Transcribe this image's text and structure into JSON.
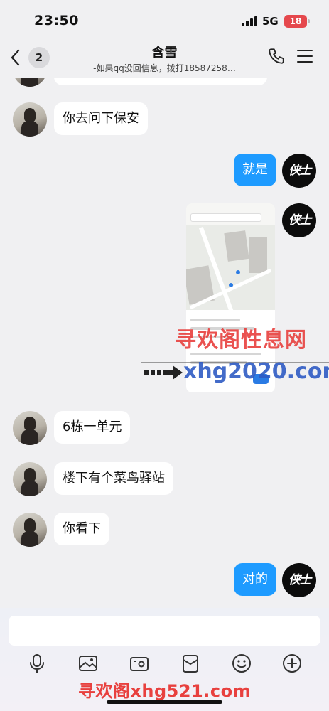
{
  "status_bar": {
    "time": "23:50",
    "network": "5G",
    "battery": "18"
  },
  "header": {
    "unread_count": "2",
    "contact_name": "含雪",
    "subtitle": "-如果qq没回信息，拨打18587258…"
  },
  "messages": [
    {
      "from": "her",
      "text": "你去问下保安"
    },
    {
      "from": "me",
      "text": "就是"
    },
    {
      "from": "me",
      "type": "image"
    },
    {
      "from": "her",
      "text": "6栋一单元"
    },
    {
      "from": "her",
      "text": "楼下有个菜鸟驿站"
    },
    {
      "from": "her",
      "text": "你看下"
    },
    {
      "from": "me",
      "text": "对的"
    }
  ],
  "my_avatar_text": "侠士",
  "watermarks": {
    "red_text": "寻欢阁性息网",
    "blue_text": "xhg2020.com",
    "bottom_text": "寻欢阁xhg521.com"
  },
  "input": {
    "value": "",
    "placeholder": ""
  },
  "toolbar_icons": [
    "microphone-icon",
    "image-icon",
    "camera-icon",
    "red-packet-icon",
    "emoji-icon",
    "plus-icon"
  ],
  "colors": {
    "outgoing_bubble": "#1e9bff",
    "watermark_red": "#e8403e",
    "watermark_blue": "#2f5bc4"
  }
}
